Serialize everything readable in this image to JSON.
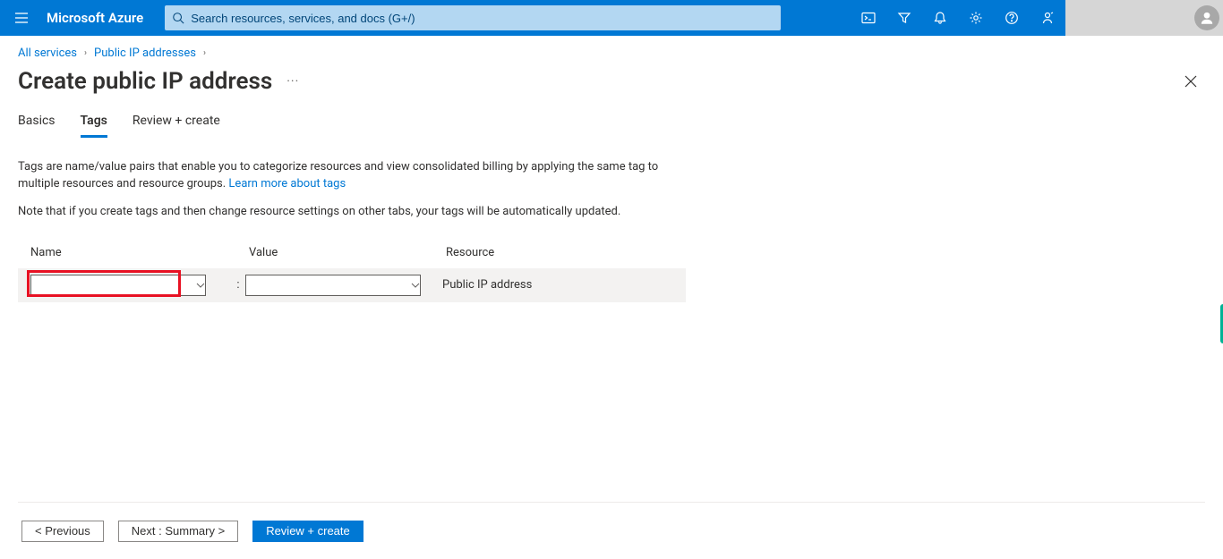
{
  "header": {
    "brand": "Microsoft Azure",
    "search_placeholder": "Search resources, services, and docs (G+/)"
  },
  "breadcrumb": {
    "items": [
      "All services",
      "Public IP addresses"
    ]
  },
  "title": "Create public IP address",
  "tabs": [
    {
      "label": "Basics",
      "active": false
    },
    {
      "label": "Tags",
      "active": true
    },
    {
      "label": "Review + create",
      "active": false
    }
  ],
  "description": {
    "line1": "Tags are name/value pairs that enable you to categorize resources and view consolidated billing by applying the same tag to multiple resources and resource groups.",
    "link_text": "Learn more about tags",
    "line2": "Note that if you create tags and then change resource settings on other tabs, your tags will be automatically updated."
  },
  "tag_table": {
    "headers": {
      "name": "Name",
      "value": "Value",
      "resource": "Resource"
    },
    "row": {
      "name": "",
      "value": "",
      "resource": "Public IP address"
    }
  },
  "footer": {
    "previous": "< Previous",
    "next": "Next : Summary >",
    "review": "Review + create"
  }
}
